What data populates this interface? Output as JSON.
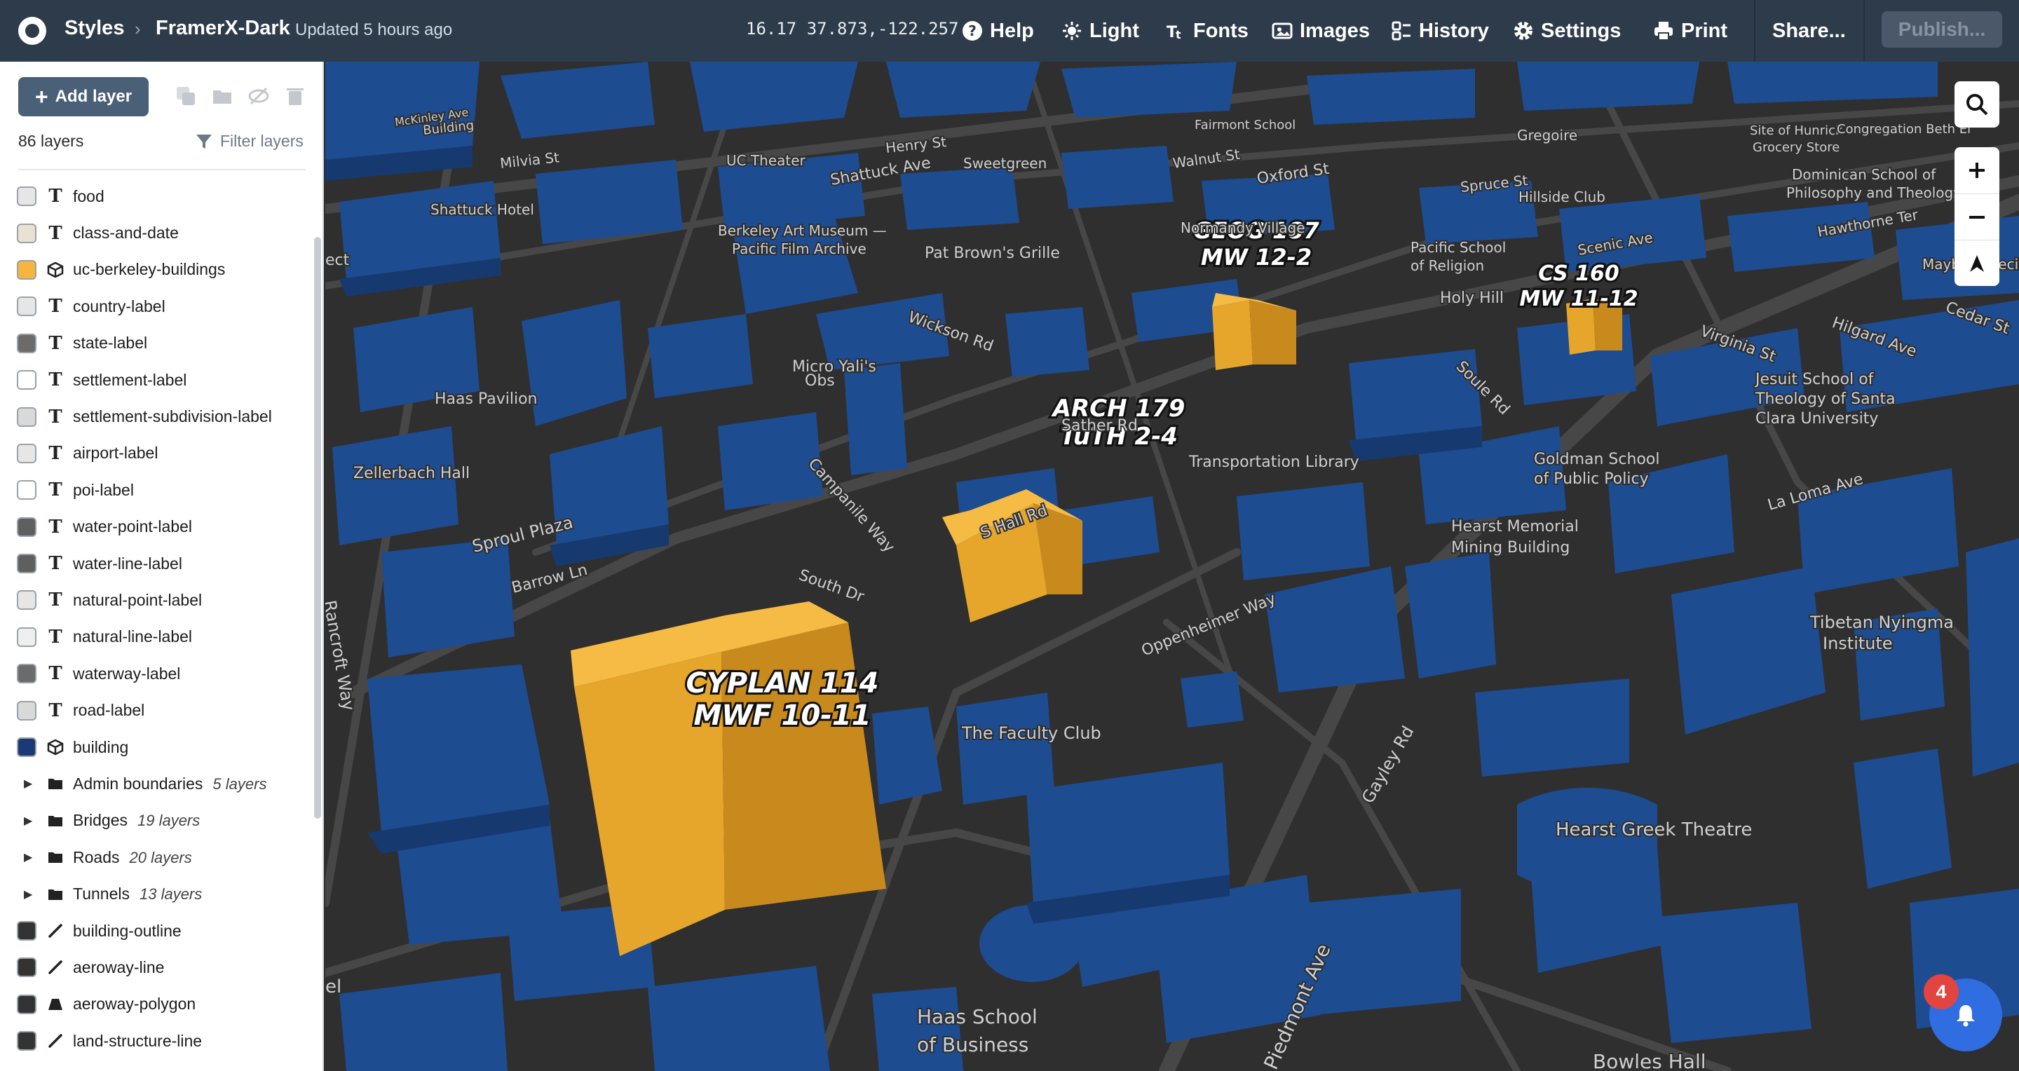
{
  "header": {
    "styles": "Styles",
    "style_name": "FramerX-Dark",
    "updated": "Updated 5 hours ago",
    "coords": "16.17  37.873,-122.257",
    "help": "Help",
    "light": "Light",
    "fonts": "Fonts",
    "images": "Images",
    "history": "History",
    "settings": "Settings",
    "print": "Print",
    "share": "Share...",
    "publish": "Publish..."
  },
  "sidebar": {
    "add_layer": "Add layer",
    "count": "86 layers",
    "filter": "Filter layers",
    "layers": [
      {
        "name": "food",
        "type": "T",
        "swatch": "#e6e6e6"
      },
      {
        "name": "class-and-date",
        "type": "T",
        "swatch": "#e9e2d3"
      },
      {
        "name": "uc-berkeley-buildings",
        "type": "box",
        "swatch": "#f4b63e"
      },
      {
        "name": "country-label",
        "type": "T",
        "swatch": "#e6e6e6"
      },
      {
        "name": "state-label",
        "type": "T",
        "swatch": "#6b6b6b"
      },
      {
        "name": "settlement-label",
        "type": "T",
        "swatch": "#ffffff"
      },
      {
        "name": "settlement-subdivision-label",
        "type": "T",
        "swatch": "#d9d9d9"
      },
      {
        "name": "airport-label",
        "type": "T",
        "swatch": "#e6e6e6"
      },
      {
        "name": "poi-label",
        "type": "T",
        "swatch": "#ffffff"
      },
      {
        "name": "water-point-label",
        "type": "T",
        "swatch": "#5f5f5f"
      },
      {
        "name": "water-line-label",
        "type": "T",
        "swatch": "#5f5f5f"
      },
      {
        "name": "natural-point-label",
        "type": "T",
        "swatch": "#e6e6e6"
      },
      {
        "name": "natural-line-label",
        "type": "T",
        "swatch": "#efefef"
      },
      {
        "name": "waterway-label",
        "type": "T",
        "swatch": "#6b6b6b"
      },
      {
        "name": "road-label",
        "type": "T",
        "swatch": "#d9d9d9"
      },
      {
        "name": "building",
        "type": "box",
        "swatch": "#1b3a75"
      }
    ],
    "groups": [
      {
        "name": "Admin boundaries",
        "sub": "5 layers"
      },
      {
        "name": "Bridges",
        "sub": "19 layers"
      },
      {
        "name": "Roads",
        "sub": "20 layers"
      },
      {
        "name": "Tunnels",
        "sub": "13 layers"
      }
    ],
    "bottom_layers": [
      {
        "name": "building-outline",
        "type": "line",
        "swatch": "#333333"
      },
      {
        "name": "aeroway-line",
        "type": "line",
        "swatch": "#333333"
      },
      {
        "name": "aeroway-polygon",
        "type": "poly",
        "swatch": "#333333"
      },
      {
        "name": "land-structure-line",
        "type": "line",
        "swatch": "#333333"
      }
    ]
  },
  "map": {
    "class_labels": [
      {
        "course": "GEOG 187",
        "time": "MW 12-2"
      },
      {
        "course": "CS 160",
        "time": "MW 11-12"
      },
      {
        "course": "ARCH 179",
        "time": "TuTH 2-4"
      },
      {
        "course": "CYPLAN 114",
        "time": "MWF 10-11"
      }
    ],
    "labels": [
      "Building",
      "Milvia St",
      "UC Theater",
      "Henry St",
      "Sweetgreen",
      "Walnut St",
      "Oxford St",
      "Shattuck Ave",
      "Shattuck Hotel",
      "Berkeley Art Museum —",
      "Pacific Film Archive",
      "Pat Brown's Grille",
      "Normandy Village",
      "Pacific School",
      "of Religion",
      "Holy Hill",
      "Scenic Ave",
      "Spruce St",
      "Hillside Club",
      "Gregoire",
      "Site of Hunrick",
      "Grocery Store",
      "Congregation Beth El",
      "Dominican School of",
      "Philosophy and Theology",
      "Hawthorne Ter",
      "Maybeck Recital",
      "Cedar St",
      "Hilgard Ave",
      "Virginia St",
      "Jesuit School of",
      "Theology of Santa",
      "Clara University",
      "Haas Pavilion",
      "Micro Yali's",
      "Wickson Rd",
      "Zellerbach Hall",
      "Sather Rd",
      "Campanile Way",
      "Sproul Plaza",
      "Barrow Ln",
      "South Dr",
      "S Hall Rd",
      "Transportation Library",
      "Goldman School",
      "of Public Policy",
      "La Loma Ave",
      "Hearst Memorial",
      "Mining Building",
      "Oppenheimer Way",
      "Tibetan Nyingma",
      "Institute",
      "Rancroft Way",
      "The Faculty Club",
      "Gayley Rd",
      "Hearst Greek Theatre",
      "Haas School",
      "of Business",
      "Piedmont Ave",
      "Bowles Hall",
      "Obs",
      "Soule Rd",
      "McKinley Ave",
      "Fairmont School",
      "ect",
      "el"
    ]
  },
  "notifications": {
    "count": "4"
  },
  "colors": {
    "topbar": "#2e3b4b",
    "accent_building": "#f4b63e",
    "blue_building": "#1e4a8c",
    "map_bg": "#2e2e2e"
  },
  "icons": [
    "logo-icon",
    "chevron-right-icon",
    "help-icon",
    "light-icon",
    "fonts-icon",
    "images-icon",
    "history-icon",
    "settings-icon",
    "print-icon",
    "plus-icon",
    "filter-icon",
    "search-icon",
    "zoom-in-icon",
    "zoom-out-icon",
    "compass-icon",
    "bell-icon"
  ]
}
